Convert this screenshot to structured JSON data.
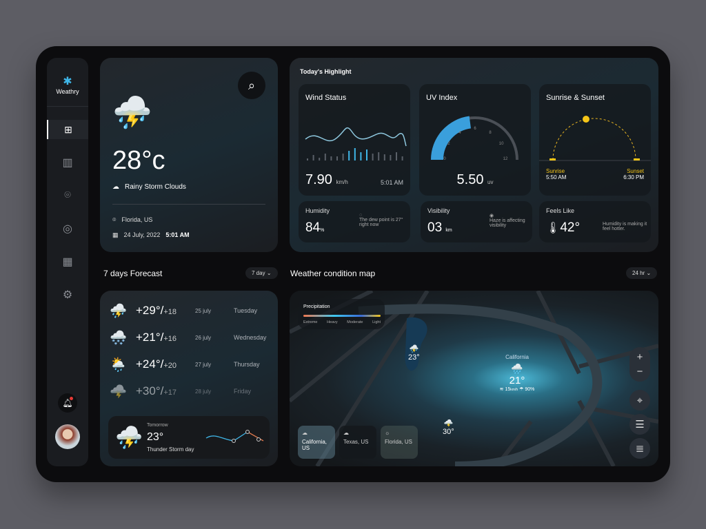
{
  "sidebar": {
    "brand": "Weathry",
    "items": [
      "dashboard",
      "map",
      "location",
      "weather-rings",
      "calendar",
      "settings"
    ],
    "active": "dashboard"
  },
  "current": {
    "temperature": "28°c",
    "condition": "Rainy Storm Clouds",
    "location": "Florida, US",
    "date": "24 July, 2022",
    "time": "5:01 AM"
  },
  "highlights": {
    "title": "Today's Highlight",
    "wind": {
      "title": "Wind Status",
      "value": "7.90",
      "unit": "km/h",
      "time": "5:01 AM"
    },
    "uv": {
      "title": "UV Index",
      "value": "5.50",
      "unit": "uv",
      "ticks": [
        "0",
        "2",
        "4",
        "6",
        "8",
        "10",
        "12"
      ],
      "level": 5.5,
      "max": 12
    },
    "sun": {
      "title": "Sunrise & Sunset",
      "sunrise_label": "Sunrise",
      "sunrise": "5:50 AM",
      "sunset_label": "Sunset",
      "sunset": "6:30 PM"
    },
    "humidity": {
      "title": "Humidity",
      "value": "84",
      "unit": "%",
      "note": "The dew point is 27° right now"
    },
    "visibility": {
      "title": "Visibility",
      "value": "03",
      "unit": "km",
      "note": "Haze is affecting visibility"
    },
    "feels": {
      "title": "Feels Like",
      "value": "42°",
      "note": "Humidity is making it feel hotter."
    }
  },
  "forecast": {
    "title": "7 days Forecast",
    "range": "7 day",
    "rows": [
      {
        "high": "+29°/",
        "low": "+18",
        "date": "25 july",
        "day": "Tuesday"
      },
      {
        "high": "+21°/",
        "low": "+16",
        "date": "26 july",
        "day": "Wednesday"
      },
      {
        "high": "+24°/",
        "low": "+20",
        "date": "27 july",
        "day": "Thursday"
      },
      {
        "high": "+30°/",
        "low": "+17",
        "date": "28 july",
        "day": "Friday"
      }
    ],
    "tomorrow": {
      "label": "Tomorrow",
      "temp": "23°",
      "condition": "Thunder Storm day"
    }
  },
  "map": {
    "title": "Weather condition map",
    "range": "24 hr",
    "legend": {
      "title": "Precipitation",
      "levels": [
        "Extreme",
        "Heavy",
        "Moderate",
        "Light"
      ]
    },
    "markers": [
      {
        "temp": "23°"
      },
      {
        "temp": "30°"
      }
    ],
    "main": {
      "name": "California",
      "temp": "21°",
      "wind": "15",
      "wind_unit": "km/h",
      "humidity": "90%"
    },
    "cities": [
      "California, US",
      "Texas, US",
      "Florida, US"
    ]
  },
  "colors": {
    "accent": "#3fb6e8",
    "sun": "#f5c518",
    "bg": "#0c0c0e"
  }
}
